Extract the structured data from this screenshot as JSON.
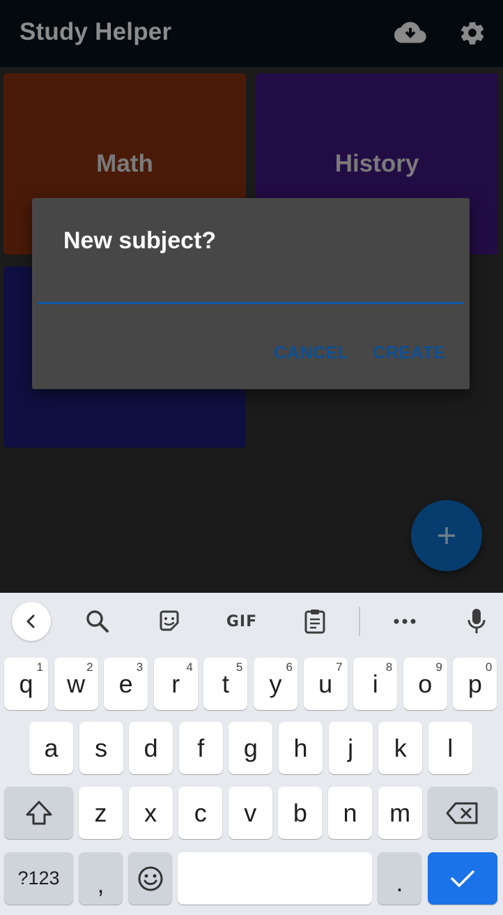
{
  "app_bar": {
    "title": "Study Helper",
    "icons": [
      "cloud-download-icon",
      "settings-gear-icon"
    ]
  },
  "subjects": [
    {
      "label": "Math",
      "color": "#4a1a08"
    },
    {
      "label": "History",
      "color": "#220c44"
    },
    {
      "label": "",
      "color": "#0f0f41"
    }
  ],
  "dialog": {
    "title": "New subject?",
    "input_value": "",
    "cancel_label": "CANCEL",
    "create_label": "CREATE",
    "accent_color": "#0d5ba8"
  },
  "fab": {
    "icon": "plus-icon",
    "color": "#073c6e"
  },
  "keyboard": {
    "toolbar": [
      "back-chevron-icon",
      "search-icon",
      "sticker-icon",
      "GIF",
      "clipboard-icon",
      "more-dots-icon",
      "microphone-icon"
    ],
    "gif_label": "GIF",
    "row1": [
      {
        "k": "q",
        "s": "1"
      },
      {
        "k": "w",
        "s": "2"
      },
      {
        "k": "e",
        "s": "3"
      },
      {
        "k": "r",
        "s": "4"
      },
      {
        "k": "t",
        "s": "5"
      },
      {
        "k": "y",
        "s": "6"
      },
      {
        "k": "u",
        "s": "7"
      },
      {
        "k": "i",
        "s": "8"
      },
      {
        "k": "o",
        "s": "9"
      },
      {
        "k": "p",
        "s": "0"
      }
    ],
    "row2": [
      "a",
      "s",
      "d",
      "f",
      "g",
      "h",
      "j",
      "k",
      "l"
    ],
    "row3": [
      "z",
      "x",
      "c",
      "v",
      "b",
      "n",
      "m"
    ],
    "sym_label": "?123",
    "comma": ",",
    "period": ".",
    "enter_color": "#1a73e8"
  }
}
